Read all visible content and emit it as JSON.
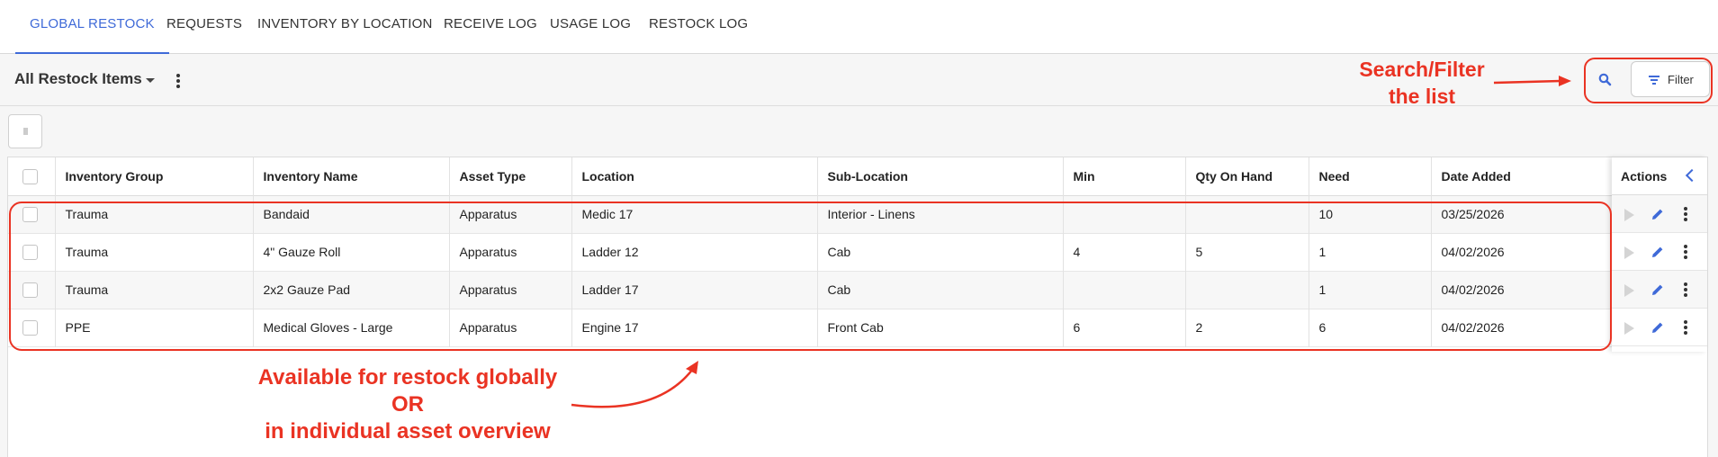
{
  "tabs": [
    {
      "label": "GLOBAL RESTOCK",
      "active": true
    },
    {
      "label": "REQUESTS"
    },
    {
      "label": "INVENTORY BY LOCATION"
    },
    {
      "label": "RECEIVE LOG"
    },
    {
      "label": "USAGE LOG"
    },
    {
      "label": "RESTOCK LOG"
    }
  ],
  "toolbar": {
    "view_title": "All Restock Items",
    "filter_label": "Filter"
  },
  "icons": {
    "search": "search-icon",
    "filter": "filter-icon",
    "view_menu": "more-vertical-icon",
    "row_play": "play-icon",
    "row_edit": "pencil-icon",
    "row_more": "more-vertical-icon",
    "collapse": "chevron-left-icon"
  },
  "table": {
    "columns": [
      "Inventory Group",
      "Inventory Name",
      "Asset Type",
      "Location",
      "Sub-Location",
      "Min",
      "Qty On Hand",
      "Need",
      "Date Added"
    ],
    "actions_label": "Actions",
    "rows": [
      {
        "group": "Trauma",
        "name": "Bandaid",
        "asset_type": "Apparatus",
        "location": "Medic 17",
        "sub_location": "Interior - Linens",
        "min": "",
        "qty": "",
        "need": "10",
        "date": "03/25/2026"
      },
      {
        "group": "Trauma",
        "name": "4\" Gauze Roll",
        "asset_type": "Apparatus",
        "location": "Ladder 12",
        "sub_location": "Cab",
        "min": "4",
        "qty": "5",
        "need": "1",
        "date": "04/02/2026"
      },
      {
        "group": "Trauma",
        "name": "2x2 Gauze Pad",
        "asset_type": "Apparatus",
        "location": "Ladder 17",
        "sub_location": "Cab",
        "min": "",
        "qty": "",
        "need": "1",
        "date": "04/02/2026"
      },
      {
        "group": "PPE",
        "name": "Medical Gloves - Large",
        "asset_type": "Apparatus",
        "location": "Engine 17",
        "sub_location": "Front Cab",
        "min": "6",
        "qty": "2",
        "need": "6",
        "date": "04/02/2026"
      }
    ]
  },
  "annotations": {
    "search_filter": [
      "Search/Filter",
      "the list"
    ],
    "restock": [
      "Available for restock globally",
      "OR",
      "in individual asset overview"
    ]
  },
  "colors": {
    "accent": "#3f6ad8",
    "annotation": "#ea3323"
  }
}
